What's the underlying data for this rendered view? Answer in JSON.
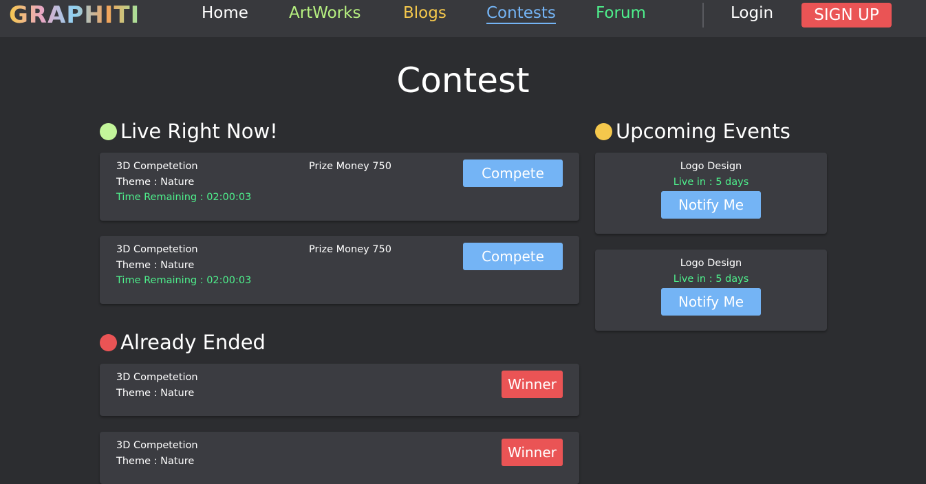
{
  "nav": {
    "logo": "GRAPHITI",
    "home": "Home",
    "artworks": "ArtWorks",
    "blogs": "Blogs",
    "contests": "Contests",
    "forum": "Forum",
    "login": "Login",
    "signup": "SIGN UP"
  },
  "page_title": "Contest",
  "live": {
    "heading": "Live Right Now!",
    "dot_color": "#c3f59a",
    "cards": [
      {
        "name": "3D Competetion",
        "theme": "Theme : Nature",
        "time": "Time Remaining : 02:00:03",
        "prize": "Prize Money 750",
        "button": "Compete"
      },
      {
        "name": "3D Competetion",
        "theme": "Theme : Nature",
        "time": "Time Remaining : 02:00:03",
        "prize": "Prize Money 750",
        "button": "Compete"
      }
    ]
  },
  "ended": {
    "heading": "Already Ended",
    "dot_color": "#ea5455",
    "cards": [
      {
        "name": "3D Competetion",
        "theme": "Theme : Nature",
        "button": "Winner"
      },
      {
        "name": "3D Competetion",
        "theme": "Theme : Nature",
        "button": "Winner"
      }
    ]
  },
  "upcoming": {
    "heading": "Upcoming Events",
    "dot_color": "#f5c84c",
    "cards": [
      {
        "name": "Logo Design",
        "live_in": "Live in : 5 days",
        "button": "Notify Me"
      },
      {
        "name": "Logo Design",
        "live_in": "Live in : 5 days",
        "button": "Notify Me"
      }
    ]
  },
  "colors": {
    "background": "#2c2d30",
    "navbar": "#38393d",
    "card": "#3b3c41",
    "accent_blue": "#74b4f5",
    "accent_red": "#ea5455",
    "accent_green": "#4ef08c"
  }
}
